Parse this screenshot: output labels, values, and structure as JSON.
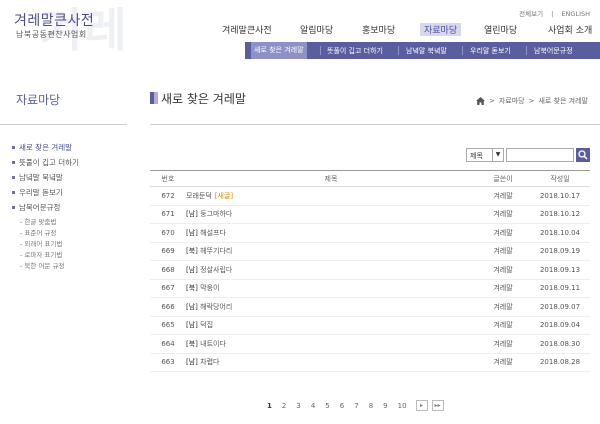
{
  "site": {
    "title": "겨레말큰사전",
    "subtitle": "남북공동편찬사업회",
    "watermark": "겨레"
  },
  "util_links": [
    "전체보기",
    "ENGLISH"
  ],
  "gnb": [
    {
      "label": "겨레말큰사전"
    },
    {
      "label": "알림마당"
    },
    {
      "label": "홍보마당"
    },
    {
      "label": "자료마당",
      "active": true
    },
    {
      "label": "열린마당"
    },
    {
      "label": "사업회 소개"
    }
  ],
  "subnav": [
    {
      "label": "새로 찾은 겨레말",
      "active": true
    },
    {
      "label": "뜻풀이 깁고 더하기"
    },
    {
      "label": "남녘말 북녘말"
    },
    {
      "label": "우리말 돋보기"
    },
    {
      "label": "남북어문규정"
    }
  ],
  "left": {
    "title": "자료마당",
    "items": [
      {
        "label": "새로 찾은 겨레말",
        "active": true
      },
      {
        "label": "뜻풀이 깁고 더하기"
      },
      {
        "label": "남녘말 북녘말"
      },
      {
        "label": "우리말 돋보기"
      },
      {
        "label": "남북어문규정"
      }
    ],
    "subitems": [
      "- 한글 맞춤법",
      "- 표준어 규정",
      "- 외래어 표기법",
      "- 로마자 표기법",
      "- 북한 어문 규정"
    ]
  },
  "page": {
    "title": "새로 찾은 겨레말",
    "breadcrumb": [
      "자료마당",
      "새로 찾은 겨레말"
    ]
  },
  "search": {
    "select_value": "제목"
  },
  "table": {
    "headers": {
      "num": "번호",
      "title": "제목",
      "author": "글쓴이",
      "date": "작성일"
    },
    "rows": [
      {
        "num": "672",
        "tag": "",
        "title": "모래둔덕",
        "new": "[새글]",
        "author": "겨레말",
        "date": "2018.10.17"
      },
      {
        "num": "671",
        "tag": "[남]",
        "title": "둥그마하다",
        "new": "",
        "author": "겨레말",
        "date": "2018.10.12"
      },
      {
        "num": "670",
        "tag": "[남]",
        "title": "해설프다",
        "new": "",
        "author": "겨레말",
        "date": "2018.10.04"
      },
      {
        "num": "669",
        "tag": "[북]",
        "title": "헤뚜기다리",
        "new": "",
        "author": "겨레말",
        "date": "2018.09.19"
      },
      {
        "num": "668",
        "tag": "[남]",
        "title": "정살사립다",
        "new": "",
        "author": "겨레말",
        "date": "2018.09.13"
      },
      {
        "num": "667",
        "tag": "[북]",
        "title": "막웅이",
        "new": "",
        "author": "겨레말",
        "date": "2018.09.11"
      },
      {
        "num": "666",
        "tag": "[남]",
        "title": "해락당어리",
        "new": "",
        "author": "겨레말",
        "date": "2018.09.07"
      },
      {
        "num": "665",
        "tag": "[남]",
        "title": "덕집",
        "new": "",
        "author": "겨레말",
        "date": "2018.09.04"
      },
      {
        "num": "664",
        "tag": "[북]",
        "title": "내트이다",
        "new": "",
        "author": "겨레말",
        "date": "2018.08.30"
      },
      {
        "num": "663",
        "tag": "[남]",
        "title": "차렵다",
        "new": "",
        "author": "겨레말",
        "date": "2018.08.28"
      }
    ]
  },
  "pagination": {
    "pages": [
      "1",
      "2",
      "3",
      "4",
      "5",
      "6",
      "7",
      "8",
      "9",
      "10"
    ],
    "current": "1",
    "next": "▸",
    "last": "▸▸"
  },
  "colors": {
    "accent": "#5b5e9e",
    "new_tag": "#e08a00"
  }
}
